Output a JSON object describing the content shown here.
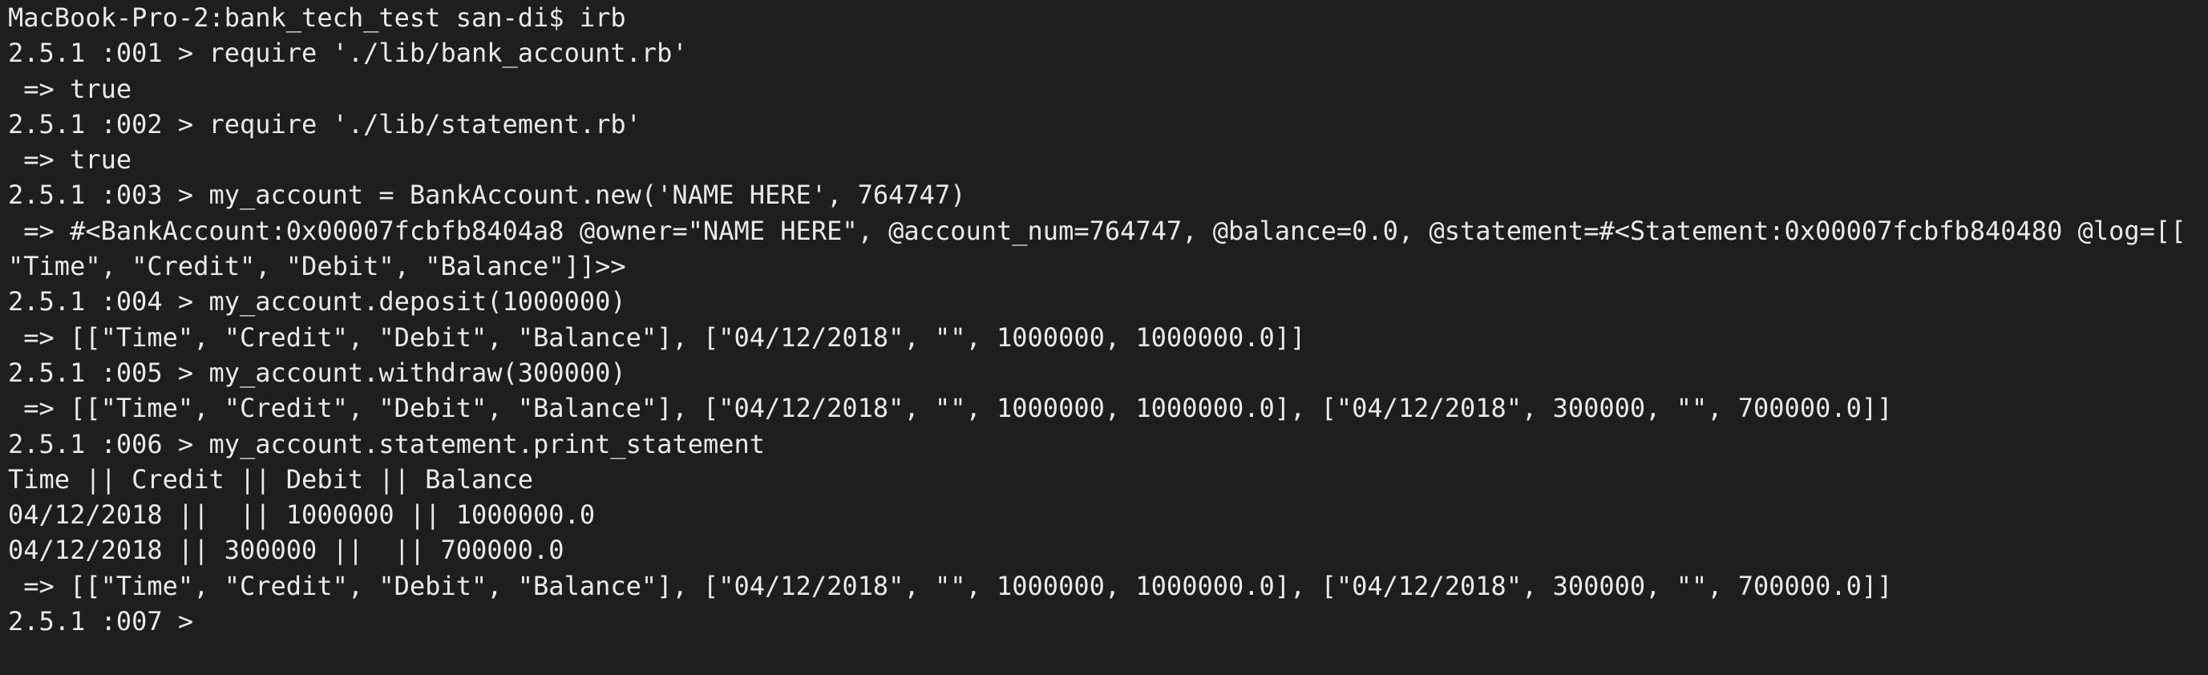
{
  "terminal": {
    "lines": [
      "MacBook-Pro-2:bank_tech_test san-di$ irb",
      "2.5.1 :001 > require './lib/bank_account.rb'",
      " => true",
      "2.5.1 :002 > require './lib/statement.rb'",
      " => true",
      "2.5.1 :003 > my_account = BankAccount.new('NAME HERE', 764747)",
      " => #<BankAccount:0x00007fcbfb8404a8 @owner=\"NAME HERE\", @account_num=764747, @balance=0.0, @statement=#<Statement:0x00007fcbfb840480 @log=[[",
      "\"Time\", \"Credit\", \"Debit\", \"Balance\"]]>>",
      "2.5.1 :004 > my_account.deposit(1000000)",
      " => [[\"Time\", \"Credit\", \"Debit\", \"Balance\"], [\"04/12/2018\", \"\", 1000000, 1000000.0]]",
      "2.5.1 :005 > my_account.withdraw(300000)",
      " => [[\"Time\", \"Credit\", \"Debit\", \"Balance\"], [\"04/12/2018\", \"\", 1000000, 1000000.0], [\"04/12/2018\", 300000, \"\", 700000.0]]",
      "2.5.1 :006 > my_account.statement.print_statement",
      "Time || Credit || Debit || Balance",
      "04/12/2018 ||  || 1000000 || 1000000.0",
      "04/12/2018 || 300000 ||  || 700000.0",
      " => [[\"Time\", \"Credit\", \"Debit\", \"Balance\"], [\"04/12/2018\", \"\", 1000000, 1000000.0], [\"04/12/2018\", 300000, \"\", 700000.0]]",
      "2.5.1 :007 > "
    ]
  },
  "colors": {
    "background": "#1e1e1e",
    "foreground": "#eaeaea"
  }
}
